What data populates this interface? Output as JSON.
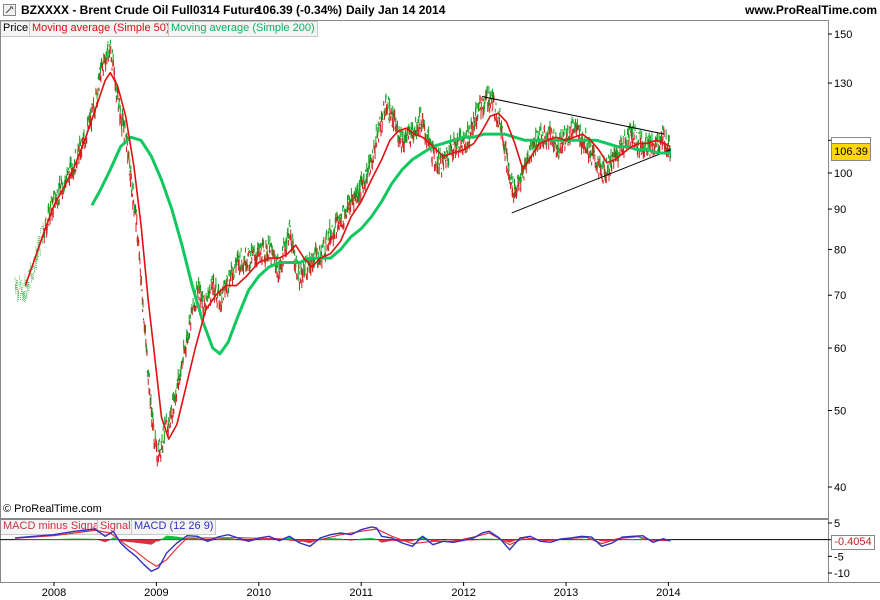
{
  "header": {
    "symbol": "BZXXXX - Brent Crude Oil Full0314 Future",
    "last": "106.39 (-0.34%)",
    "period": "Daily  Jan 14 2014",
    "site": "www.ProRealTime.com"
  },
  "legend_price": {
    "price": "Price",
    "ma50": "Moving average (Simple 50)",
    "ma200": "Moving average (Simple 200)"
  },
  "legend_macd": {
    "hist": "MACD minus Signal",
    "signal": "Signal",
    "macd": "MACD (12 26 9)"
  },
  "copyright": "© ProRealTime.com",
  "price_flag": "106.39",
  "macd_flag": "-0.4054",
  "colors": {
    "ma50": "#e01010",
    "ma200": "#10c860",
    "macd": "#3030c0",
    "signal": "#e03040",
    "hist_up": "#10c040",
    "hist_down": "#e03040",
    "candle_up": "#10a020",
    "candle_down": "#d02020"
  },
  "chart_data": [
    {
      "type": "line",
      "y_scale": "log",
      "ylim": [
        38,
        158
      ],
      "y_ticks": [
        150,
        130,
        110,
        100,
        90,
        80,
        70,
        60,
        50,
        40
      ],
      "y_tick_labels": [
        "150",
        "130",
        "",
        "100",
        "90",
        "80",
        "70",
        "60",
        "50",
        "40"
      ],
      "x_ticks": [
        "2008",
        "2009",
        "2010",
        "2011",
        "2012",
        "2013",
        "2014"
      ],
      "x_tick_years": [
        2008,
        2009,
        2010,
        2011,
        2012,
        2013,
        2014
      ],
      "x_range": [
        2007.6,
        2014.25
      ],
      "series": [
        {
          "name": "Price",
          "x": [
            2007.62,
            2007.7,
            2007.8,
            2007.9,
            2008.0,
            2008.1,
            2008.2,
            2008.3,
            2008.4,
            2008.45,
            2008.5,
            2008.55,
            2008.6,
            2008.65,
            2008.7,
            2008.75,
            2008.8,
            2008.85,
            2008.9,
            2008.95,
            2009.0,
            2009.04,
            2009.08,
            2009.12,
            2009.18,
            2009.25,
            2009.32,
            2009.4,
            2009.48,
            2009.55,
            2009.62,
            2009.7,
            2009.78,
            2009.85,
            2009.92,
            2010.0,
            2010.1,
            2010.2,
            2010.3,
            2010.35,
            2010.4,
            2010.45,
            2010.5,
            2010.55,
            2010.6,
            2010.7,
            2010.8,
            2010.9,
            2011.0,
            2011.1,
            2011.18,
            2011.25,
            2011.3,
            2011.35,
            2011.42,
            2011.5,
            2011.58,
            2011.65,
            2011.72,
            2011.8,
            2011.88,
            2011.95,
            2012.05,
            2012.12,
            2012.18,
            2012.25,
            2012.32,
            2012.38,
            2012.45,
            2012.5,
            2012.55,
            2012.62,
            2012.7,
            2012.78,
            2012.85,
            2012.92,
            2013.0,
            2013.08,
            2013.12,
            2013.2,
            2013.28,
            2013.35,
            2013.42,
            2013.5,
            2013.58,
            2013.65,
            2013.72,
            2013.8,
            2013.88,
            2013.95,
            2014.02
          ],
          "values": [
            73,
            70,
            76,
            84,
            92,
            97,
            103,
            110,
            122,
            133,
            140,
            144,
            130,
            118,
            112,
            98,
            88,
            73,
            60,
            50,
            44,
            45,
            47,
            48,
            52,
            57,
            64,
            71,
            68,
            72,
            69,
            73,
            77,
            78,
            78,
            79,
            80,
            75,
            85,
            78,
            73,
            76,
            76,
            79,
            78,
            84,
            87,
            92,
            96,
            103,
            115,
            122,
            118,
            113,
            110,
            113,
            117,
            110,
            104,
            103,
            108,
            109,
            111,
            118,
            122,
            125,
            120,
            113,
            98,
            95,
            97,
            104,
            110,
            111,
            112,
            108,
            111,
            115,
            112,
            109,
            104,
            100,
            102,
            106,
            110,
            112,
            109,
            108,
            108,
            111,
            107
          ]
        },
        {
          "name": "Moving average (Simple 50)",
          "x": [
            2007.72,
            2007.8,
            2007.9,
            2008.0,
            2008.1,
            2008.2,
            2008.3,
            2008.4,
            2008.5,
            2008.55,
            2008.62,
            2008.7,
            2008.78,
            2008.85,
            2008.92,
            2009.0,
            2009.05,
            2009.12,
            2009.2,
            2009.28,
            2009.38,
            2009.48,
            2009.58,
            2009.68,
            2009.78,
            2009.88,
            2010.0,
            2010.1,
            2010.2,
            2010.28,
            2010.36,
            2010.44,
            2010.52,
            2010.6,
            2010.7,
            2010.8,
            2010.9,
            2011.0,
            2011.1,
            2011.2,
            2011.28,
            2011.36,
            2011.44,
            2011.52,
            2011.6,
            2011.7,
            2011.8,
            2011.9,
            2012.0,
            2012.1,
            2012.18,
            2012.26,
            2012.34,
            2012.42,
            2012.5,
            2012.58,
            2012.66,
            2012.74,
            2012.82,
            2012.9,
            2013.0,
            2013.08,
            2013.16,
            2013.24,
            2013.32,
            2013.4,
            2013.48,
            2013.56,
            2013.64,
            2013.72,
            2013.8,
            2013.88,
            2013.96,
            2014.02
          ],
          "values": [
            72,
            77,
            84,
            91,
            96,
            102,
            110,
            120,
            131,
            134,
            129,
            118,
            102,
            86,
            69,
            56,
            49,
            46,
            48,
            53,
            60,
            67,
            70,
            72,
            72,
            74,
            77,
            78,
            78,
            79,
            81,
            78,
            76,
            78,
            79,
            82,
            88,
            92,
            98,
            104,
            110,
            113,
            114,
            112,
            111,
            108,
            105,
            106,
            107,
            109,
            113,
            118,
            119,
            116,
            109,
            101,
            105,
            109,
            110,
            111,
            110,
            111,
            112,
            110,
            107,
            103,
            104,
            106,
            108,
            109,
            109,
            110,
            109,
            108
          ]
        },
        {
          "name": "Moving average (Simple 200)",
          "x": [
            2008.37,
            2008.45,
            2008.55,
            2008.65,
            2008.75,
            2008.85,
            2008.95,
            2009.05,
            2009.15,
            2009.25,
            2009.35,
            2009.45,
            2009.55,
            2009.62,
            2009.7,
            2009.8,
            2009.9,
            2010.0,
            2010.1,
            2010.2,
            2010.3,
            2010.4,
            2010.5,
            2010.6,
            2010.7,
            2010.8,
            2010.9,
            2011.0,
            2011.1,
            2011.2,
            2011.3,
            2011.4,
            2011.5,
            2011.6,
            2011.7,
            2011.8,
            2011.9,
            2012.0,
            2012.1,
            2012.2,
            2012.3,
            2012.4,
            2012.5,
            2012.6,
            2012.7,
            2012.8,
            2012.9,
            2013.0,
            2013.1,
            2013.2,
            2013.3,
            2013.4,
            2013.5,
            2013.6,
            2013.7,
            2013.8,
            2013.9,
            2014.0,
            2014.02
          ],
          "values": [
            91,
            95,
            101,
            108,
            111,
            110,
            105,
            98,
            90,
            81,
            72,
            65,
            60,
            59,
            61,
            66,
            71,
            74,
            76,
            77,
            77,
            77,
            78,
            78,
            78,
            80,
            83,
            85,
            88,
            92,
            97,
            101,
            104,
            106,
            108,
            109,
            110,
            111,
            111,
            112,
            112,
            112,
            111,
            110,
            110,
            110,
            110,
            110,
            110,
            110,
            110,
            109,
            108,
            108,
            107,
            107,
            106,
            106,
            106
          ]
        }
      ],
      "trendlines": [
        {
          "x": [
            2012.18,
            2013.96
          ],
          "values": [
            125,
            112
          ]
        },
        {
          "x": [
            2012.47,
            2014.02
          ],
          "values": [
            89,
            107
          ]
        }
      ]
    },
    {
      "type": "line",
      "ylim": [
        -11,
        6
      ],
      "y_ticks": [
        5,
        0,
        -5,
        -10
      ],
      "y_tick_labels": [
        "5",
        "",
        "-5",
        "-10"
      ],
      "series": [
        {
          "name": "MACD (12 26 9)",
          "x": [
            2007.62,
            2007.8,
            2008.0,
            2008.2,
            2008.4,
            2008.5,
            2008.58,
            2008.65,
            2008.72,
            2008.8,
            2008.88,
            2008.95,
            2009.02,
            2009.1,
            2009.2,
            2009.3,
            2009.4,
            2009.5,
            2009.6,
            2009.7,
            2009.8,
            2009.9,
            2010.0,
            2010.1,
            2010.2,
            2010.3,
            2010.4,
            2010.5,
            2010.6,
            2010.7,
            2010.8,
            2010.9,
            2011.0,
            2011.1,
            2011.15,
            2011.2,
            2011.3,
            2011.4,
            2011.5,
            2011.6,
            2011.7,
            2011.8,
            2011.9,
            2012.0,
            2012.1,
            2012.18,
            2012.25,
            2012.35,
            2012.45,
            2012.55,
            2012.65,
            2012.75,
            2012.85,
            2012.95,
            2013.05,
            2013.15,
            2013.25,
            2013.35,
            2013.45,
            2013.55,
            2013.65,
            2013.75,
            2013.85,
            2013.95,
            2014.02
          ],
          "values": [
            0.5,
            1.0,
            1.5,
            2.5,
            3.2,
            1.0,
            2.5,
            -1.0,
            -3.0,
            -5.0,
            -7.5,
            -9.5,
            -8.5,
            -4.0,
            -1.0,
            1.2,
            1.0,
            -0.5,
            0.8,
            1.5,
            0.5,
            -0.5,
            0.5,
            1.0,
            -0.3,
            1.0,
            -1.0,
            -2.0,
            0.5,
            1.5,
            2.0,
            1.5,
            3.0,
            3.8,
            3.5,
            1.0,
            0.5,
            -1.0,
            -2.0,
            1.0,
            -1.5,
            -0.5,
            -0.8,
            -0.2,
            0.5,
            2.0,
            2.5,
            0.5,
            -3.0,
            0.5,
            1.0,
            -0.5,
            -0.8,
            0.2,
            0.5,
            1.0,
            0.8,
            -2.0,
            -1.0,
            0.8,
            1.0,
            1.2,
            -0.8,
            0.3,
            -0.4
          ]
        },
        {
          "name": "Signal",
          "x": [
            2007.62,
            2007.8,
            2008.0,
            2008.2,
            2008.4,
            2008.55,
            2008.7,
            2008.8,
            2008.9,
            2009.0,
            2009.1,
            2009.2,
            2009.3,
            2009.45,
            2009.6,
            2009.8,
            2010.0,
            2010.2,
            2010.4,
            2010.6,
            2010.8,
            2011.0,
            2011.15,
            2011.3,
            2011.5,
            2011.7,
            2011.9,
            2012.1,
            2012.25,
            2012.45,
            2012.6,
            2012.8,
            2013.0,
            2013.2,
            2013.35,
            2013.5,
            2013.7,
            2013.85,
            2014.02
          ],
          "values": [
            0.4,
            0.8,
            1.2,
            2.0,
            2.8,
            2.0,
            -1.5,
            -3.5,
            -6.0,
            -8.0,
            -6.0,
            -2.5,
            0.5,
            0.5,
            0.5,
            0.6,
            0.4,
            0.3,
            -0.5,
            0.0,
            1.5,
            2.5,
            3.2,
            1.0,
            -1.2,
            -0.5,
            -0.5,
            0.8,
            2.0,
            -1.5,
            0.6,
            -0.3,
            0.3,
            0.7,
            -1.2,
            0.3,
            0.9,
            -0.2,
            -0.3
          ]
        }
      ],
      "hist_up_x": [
        2008.3,
        2009.3,
        2009.7,
        2010.8,
        2011.1,
        2012.2,
        2012.6,
        2013.1,
        2013.6
      ],
      "hist_down_x": [
        2008.7,
        2008.95,
        2010.4,
        2011.5,
        2012.45,
        2013.35,
        2013.85
      ]
    }
  ]
}
